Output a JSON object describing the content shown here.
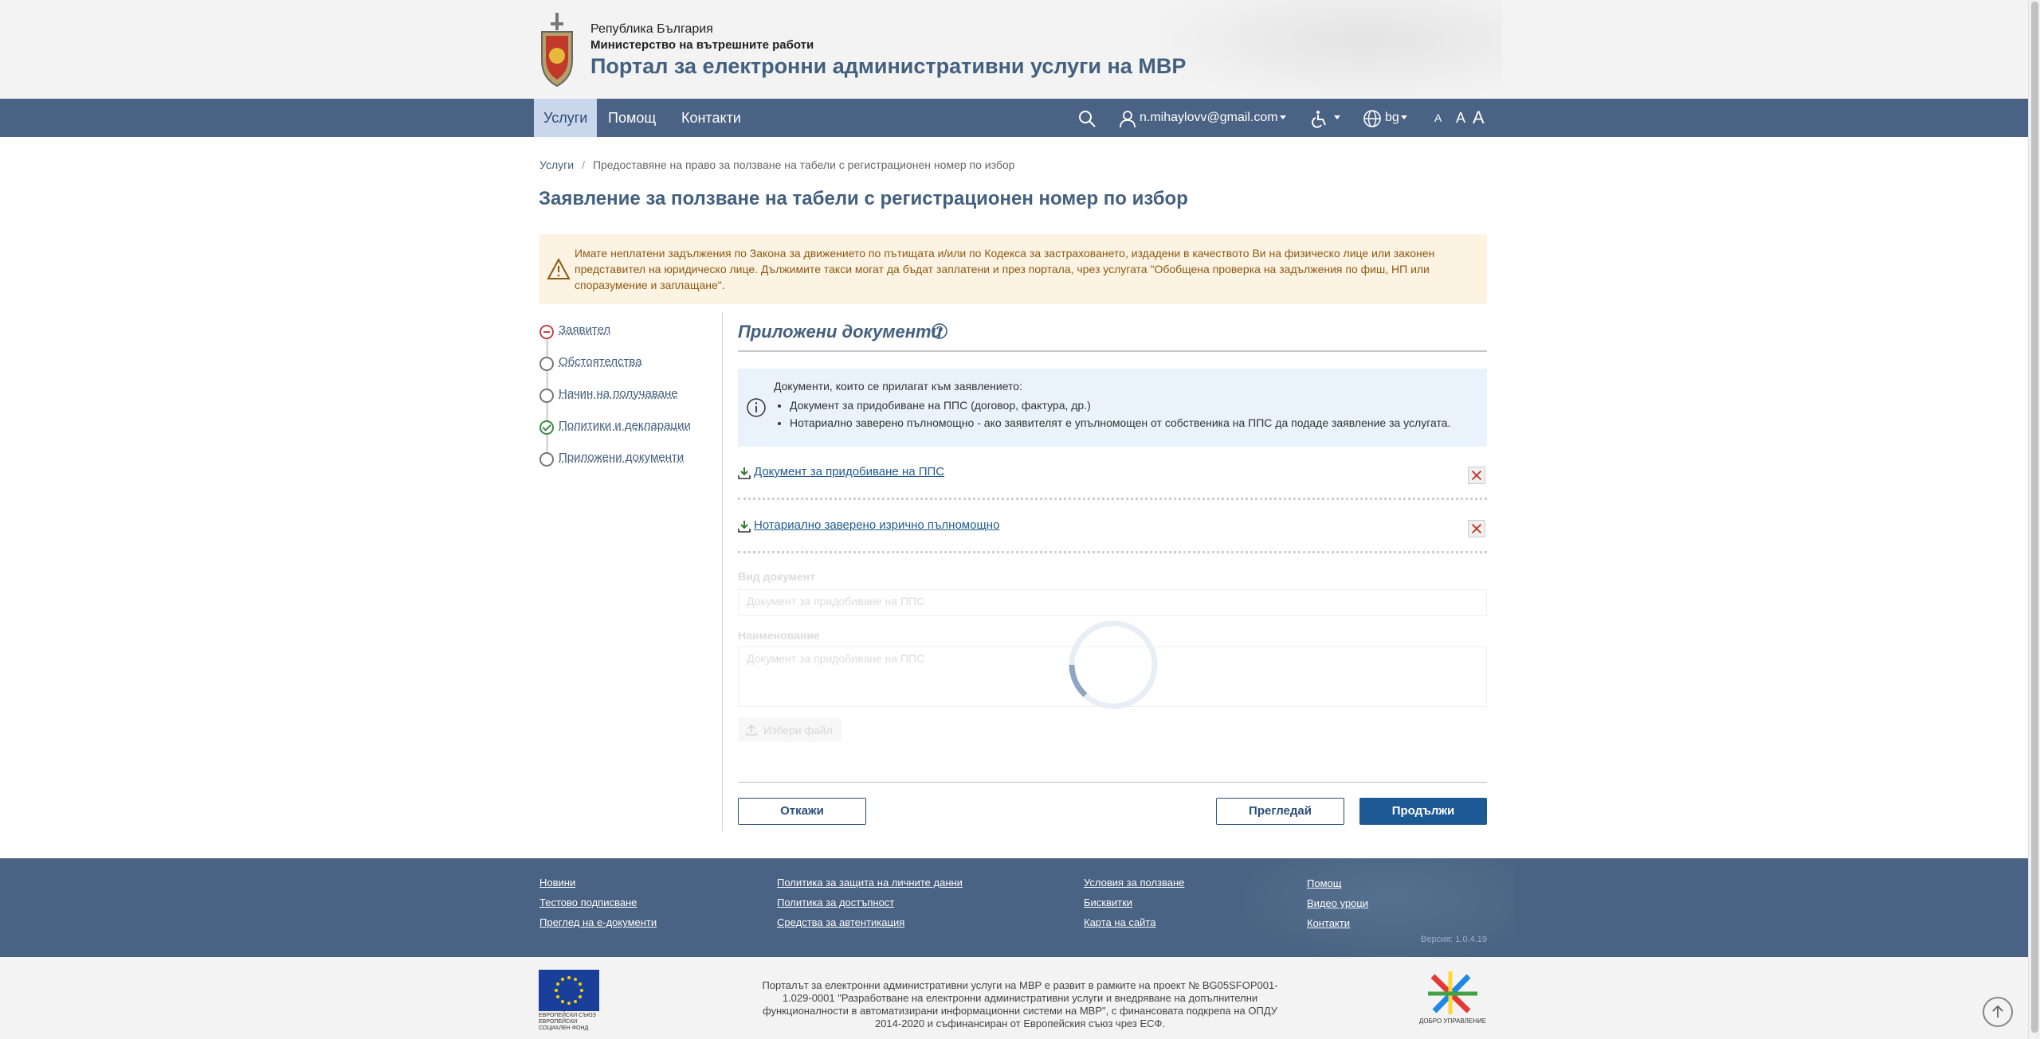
{
  "header": {
    "republic": "Република България",
    "ministry": "Министерство на вътрешните работи",
    "portal_title": "Портал за електронни административни услуги на МВР"
  },
  "nav": {
    "items": [
      {
        "label": "Услуги",
        "active": true
      },
      {
        "label": "Помощ",
        "active": false
      },
      {
        "label": "Контакти",
        "active": false
      }
    ],
    "search_icon": "search-icon",
    "user_email": "n.mihaylovv@gmail.com",
    "accessibility_icon": "accessibility-icon",
    "language": "bg",
    "font_sizes": [
      "A",
      "A",
      "A"
    ]
  },
  "breadcrumb": {
    "home": "Услуги",
    "separator": "/",
    "current": "Предоставяне на право за ползване на табели с регистрационен номер по избор"
  },
  "page_title": "Заявление за ползване на табели с регистрационен номер по избор",
  "warning": {
    "text": "Имате неплатени задължения по Закона за движението по пътищата и/или по Кодекса за застраховането, издадени в качеството Ви на физическо лице или законен представител на юридическо лице. Дължимите такси могат да бъдат заплатени и през портала, чрез услугата \"Обобщена проверка на задължения по фиш, НП или споразумение и заплащане\"."
  },
  "steps": [
    {
      "label": "Заявител",
      "status": "error"
    },
    {
      "label": "Обстоятелства",
      "status": "none"
    },
    {
      "label": "Начин на получаване",
      "status": "none"
    },
    {
      "label": "Политики и декларации",
      "status": "ok"
    },
    {
      "label": "Приложени документи",
      "status": "none"
    }
  ],
  "section": {
    "title": "Приложени документи",
    "info_intro": "Документи, които се прилагат към заявлението:",
    "info_items": [
      "Документ за придобиване на ППС (договор, фактура, др.)",
      "Нотариално заверено пълномощно - ако заявителят е упълномощен от собственика на ППС да подаде заявление за услугата."
    ],
    "documents": [
      {
        "label": "Документ за придобиване на ППС"
      },
      {
        "label": "Нотариално заверено изрично пълномощно"
      }
    ],
    "form": {
      "doc_type_label": "Вид документ",
      "doc_type_value": "Документ за придобиване на ППС",
      "name_label": "Наименование",
      "name_value": "Документ за придобиване на ППС",
      "pick_file": "Избери файл"
    }
  },
  "buttons": {
    "cancel": "Откажи",
    "review": "Прегледай",
    "continue": "Продължи"
  },
  "footer": {
    "col1": [
      "Новини",
      "Тестово подписване",
      "Преглед на е-документи"
    ],
    "col2": [
      "Политика за защита на личните данни",
      "Политика за достъпност",
      "Средства за автентикация"
    ],
    "col3": [
      "Условия за ползване",
      "Бисквитки",
      "Карта на сайта"
    ],
    "col4": [
      "Помощ",
      "Видео уроци",
      "Контакти"
    ],
    "version": "Версия: 1.0.4.19"
  },
  "subfooter": {
    "text": "Порталът за електронни административни услуги на МВР е развит в рамките на проект № BG05SFOP001-1.029-0001 \"Разработване на електронни административни услуги и внедряване на допълнителни функционалности в автоматизирани информационни системи на МВР\", с финансовата подкрепа на ОПДУ 2014-2020 и съфинансиран от Европейския съюз чрез ЕСФ.",
    "eu_logo_text": "ЕВРОПЕЙСКИ СЪЮЗ ЕВРОПЕЙСКИ СОЦИАЛЕН ФОНД",
    "gg_logo_text": "ДОБРО УПРАВЛЕНИЕ"
  },
  "colors": {
    "navbar": "#4a6283",
    "title": "#44607f",
    "primary_button": "#1d5a95",
    "warning_bg": "#fdf3e3",
    "info_bg": "#eaf3fb"
  }
}
